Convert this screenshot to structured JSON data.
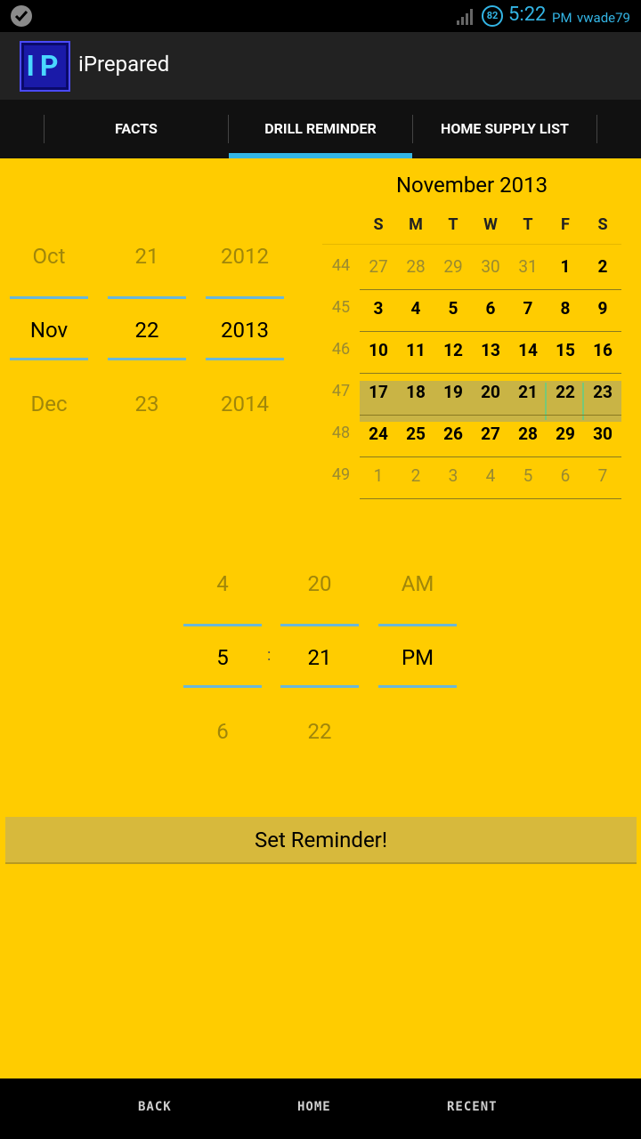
{
  "status_bar": {
    "battery": "82",
    "time": "5:22",
    "ampm": "PM",
    "user": "vwade79"
  },
  "action_bar": {
    "logo_text": "IP",
    "title": "iPrepared"
  },
  "tabs": [
    {
      "label": "FACTS",
      "active": false
    },
    {
      "label": "DRILL REMINDER",
      "active": true
    },
    {
      "label": "HOME SUPPLY LIST",
      "active": false
    }
  ],
  "date_picker": {
    "month": {
      "prev": "Oct",
      "current": "Nov",
      "next": "Dec"
    },
    "day": {
      "prev": "21",
      "current": "22",
      "next": "23"
    },
    "year": {
      "prev": "2012",
      "current": "2013",
      "next": "2014"
    }
  },
  "calendar": {
    "title": "November 2013",
    "weekdays": [
      "S",
      "M",
      "T",
      "W",
      "T",
      "F",
      "S"
    ],
    "weeks": [
      {
        "num": "44",
        "days": [
          "27",
          "28",
          "29",
          "30",
          "31",
          "1",
          "2"
        ],
        "other_mask": [
          true,
          true,
          true,
          true,
          true,
          false,
          false
        ]
      },
      {
        "num": "45",
        "days": [
          "3",
          "4",
          "5",
          "6",
          "7",
          "8",
          "9"
        ],
        "other_mask": [
          false,
          false,
          false,
          false,
          false,
          false,
          false
        ]
      },
      {
        "num": "46",
        "days": [
          "10",
          "11",
          "12",
          "13",
          "14",
          "15",
          "16"
        ],
        "other_mask": [
          false,
          false,
          false,
          false,
          false,
          false,
          false
        ]
      },
      {
        "num": "47",
        "days": [
          "17",
          "18",
          "19",
          "20",
          "21",
          "22",
          "23"
        ],
        "other_mask": [
          false,
          false,
          false,
          false,
          false,
          false,
          false
        ]
      },
      {
        "num": "48",
        "days": [
          "24",
          "25",
          "26",
          "27",
          "28",
          "29",
          "30"
        ],
        "other_mask": [
          false,
          false,
          false,
          false,
          false,
          false,
          false
        ]
      },
      {
        "num": "49",
        "days": [
          "1",
          "2",
          "3",
          "4",
          "5",
          "6",
          "7"
        ],
        "other_mask": [
          true,
          true,
          true,
          true,
          true,
          true,
          true
        ]
      }
    ],
    "selected_day": "22"
  },
  "time_picker": {
    "hour": {
      "prev": "4",
      "current": "5",
      "next": "6"
    },
    "minute": {
      "prev": "20",
      "current": "21",
      "next": "22"
    },
    "ampm": {
      "prev": "AM",
      "current": "PM"
    },
    "separator": ":"
  },
  "set_button": "Set Reminder!",
  "nav_bar": {
    "back": "BACK",
    "home": "HOME",
    "recent": "RECENT"
  }
}
